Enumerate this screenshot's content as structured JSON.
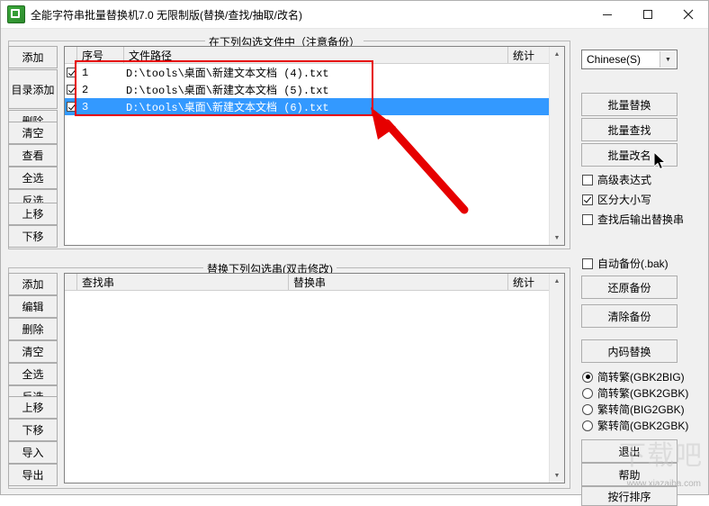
{
  "window": {
    "title": "全能字符串批量替换机7.0 无限制版(替换/查找/抽取/改名)",
    "minimize_label": "—",
    "maximize_label": "□",
    "close_label": "✕"
  },
  "file_panel": {
    "title": "在下列勾选文件中（注意备份）",
    "columns": [
      "序号",
      "文件路径",
      "统计"
    ],
    "rows": [
      {
        "checked": true,
        "index": "1",
        "path": "D:\\tools\\桌面\\新建文本文档 (4).txt",
        "stat": "",
        "selected": false
      },
      {
        "checked": true,
        "index": "2",
        "path": "D:\\tools\\桌面\\新建文本文档 (5).txt",
        "stat": "",
        "selected": false
      },
      {
        "checked": true,
        "index": "3",
        "path": "D:\\tools\\桌面\\新建文本文档 (6).txt",
        "stat": "",
        "selected": true
      }
    ],
    "buttons": [
      "添加",
      "目录添加",
      "删除",
      "清空",
      "查看",
      "全选",
      "反选",
      "上移",
      "下移"
    ]
  },
  "replace_panel": {
    "title": "替换下列勾选串(双击修改)",
    "columns": [
      "查找串",
      "替换串",
      "统计"
    ],
    "rows": [],
    "buttons": [
      "添加",
      "编辑",
      "删除",
      "清空",
      "全选",
      "反选",
      "上移",
      "下移",
      "导入",
      "导出"
    ]
  },
  "right_panel": {
    "language_combo": "Chinese(S)",
    "action_buttons": [
      "批量替换",
      "批量查找",
      "批量改名"
    ],
    "options": [
      {
        "label": "高级表达式",
        "checked": false
      },
      {
        "label": "区分大小写",
        "checked": true
      },
      {
        "label": "查找后输出替换串",
        "checked": false
      }
    ],
    "backup": {
      "auto_backup": {
        "label": "自动备份(.bak)",
        "checked": false
      },
      "restore_button": "还原备份",
      "clear_button": "清除备份"
    },
    "encoding": {
      "button": "内码替换",
      "radios": [
        {
          "label": "简转繁(GBK2BIG)",
          "checked": true
        },
        {
          "label": "简转繁(GBK2GBK)",
          "checked": false
        },
        {
          "label": "繁转简(BIG2GBK)",
          "checked": false
        },
        {
          "label": "繁转简(GBK2GBK)",
          "checked": false
        }
      ]
    },
    "bottom_buttons": [
      "退出",
      "帮助",
      "按行排序"
    ]
  },
  "watermark": {
    "main": "下载吧",
    "sub": "www.xiazaiba.com"
  }
}
